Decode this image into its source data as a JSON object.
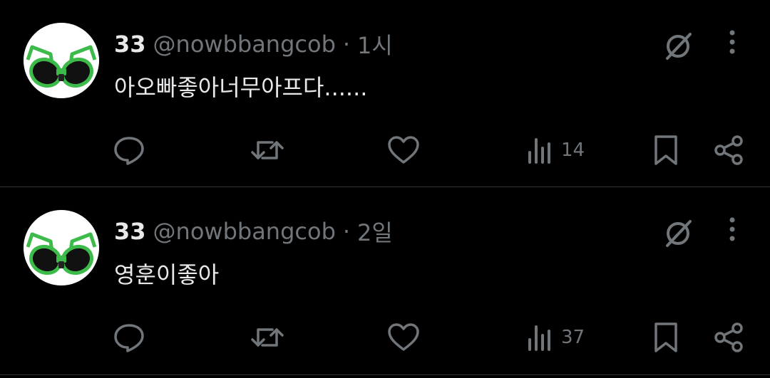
{
  "tweets": [
    {
      "name": "33",
      "handle": "@nowbbangcob",
      "separator": "·",
      "time": "1시",
      "text": "아오빠좋아너무아프다......",
      "views": "14"
    },
    {
      "name": "33",
      "handle": "@nowbbangcob",
      "separator": "·",
      "time": "2일",
      "text": "영훈이좋아",
      "views": "37"
    }
  ],
  "colors": {
    "background": "#000000",
    "text_primary": "#e7e9ea",
    "text_secondary": "#71767b",
    "divider": "#2f3336",
    "avatar_frame_green": "#3dbb4a"
  },
  "icons": [
    "grok-icon",
    "more-icon",
    "reply-icon",
    "retweet-icon",
    "like-icon",
    "views-icon",
    "bookmark-icon",
    "share-icon"
  ]
}
